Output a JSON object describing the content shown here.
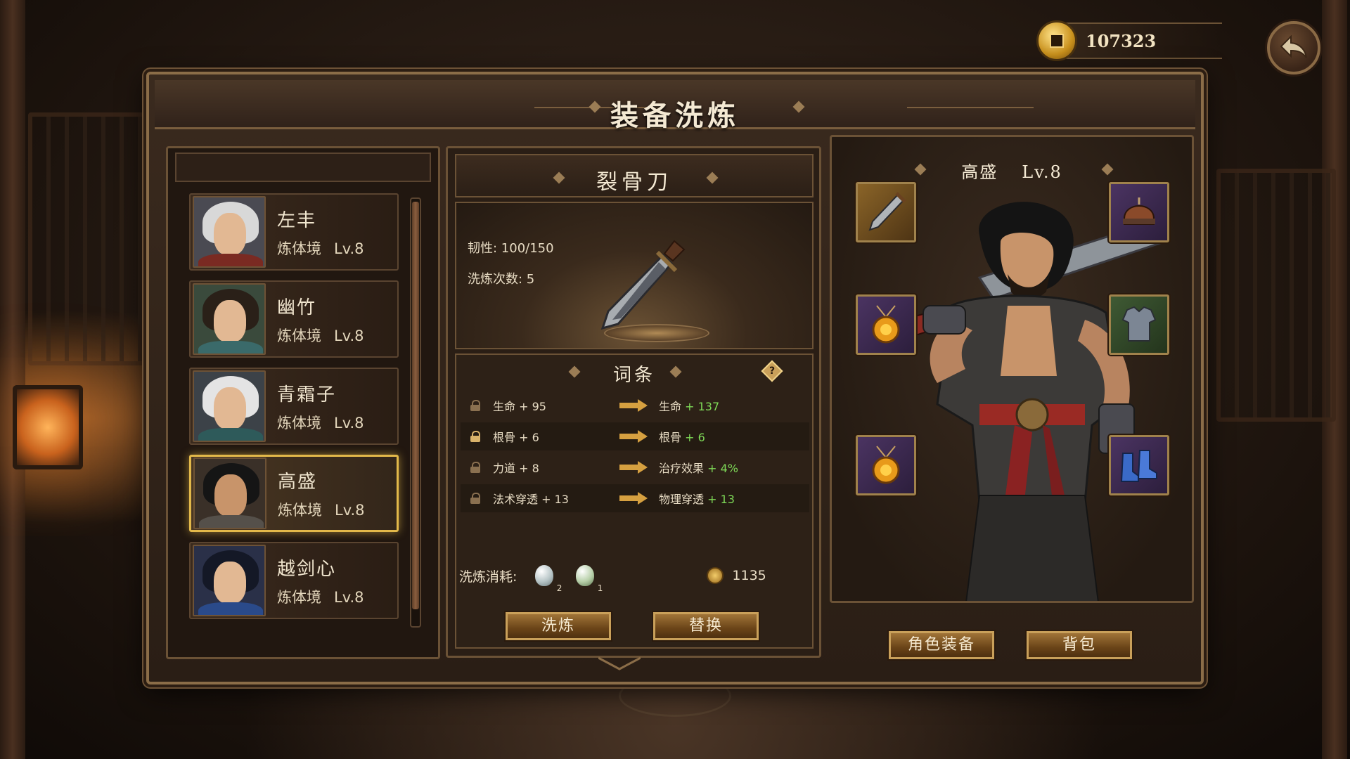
{
  "currency": {
    "gold": "107323"
  },
  "panel": {
    "title": "装备洗炼"
  },
  "heroes": [
    {
      "name": "左丰",
      "realm": "炼体境",
      "level": "Lv.8"
    },
    {
      "name": "幽竹",
      "realm": "炼体境",
      "level": "Lv.8"
    },
    {
      "name": "青霜子",
      "realm": "炼体境",
      "level": "Lv.8"
    },
    {
      "name": "高盛",
      "realm": "炼体境",
      "level": "Lv.8"
    },
    {
      "name": "越剑心",
      "realm": "炼体境",
      "level": "Lv.8"
    }
  ],
  "selected_hero_index": 3,
  "equipment": {
    "name": "裂骨刀",
    "durability": "韧性: 100/150",
    "refine_count": "洗炼次数: 5"
  },
  "affixes": {
    "title": "词条",
    "help_glyph": "?",
    "rows": [
      {
        "old_name": "生命",
        "old_value": "+ 95",
        "new_name": "生命",
        "new_value": "+ 137",
        "locked": false
      },
      {
        "old_name": "根骨",
        "old_value": "+ 6",
        "new_name": "根骨",
        "new_value": "+ 6",
        "locked": true
      },
      {
        "old_name": "力道",
        "old_value": "+ 8",
        "new_name": "治疗效果",
        "new_value": "+ 4%",
        "locked": false
      },
      {
        "old_name": "法术穿透",
        "old_value": "+ 13",
        "new_name": "物理穿透",
        "new_value": "+ 13",
        "locked": false
      }
    ]
  },
  "cost": {
    "label": "洗炼消耗:",
    "white_stone_count": "2",
    "green_stone_count": "1",
    "gold": "1135"
  },
  "buttons": {
    "refine": "洗炼",
    "replace": "替换",
    "character_equipment": "角色装备",
    "backpack": "背包"
  },
  "character": {
    "name": "高盛",
    "level": "Lv.8"
  },
  "equipment_slots": [
    {
      "slot": "weapon",
      "icon": "blade-icon"
    },
    {
      "slot": "helmet",
      "icon": "helmet-icon"
    },
    {
      "slot": "amulet",
      "icon": "amulet-icon"
    },
    {
      "slot": "armor",
      "icon": "armor-icon"
    },
    {
      "slot": "accessory",
      "icon": "amulet-icon"
    },
    {
      "slot": "boots",
      "icon": "boots-icon"
    }
  ],
  "colors": {
    "accent_gold": "#e2b84a",
    "positive_value": "#7ed957",
    "panel_border": "#8b6d48"
  }
}
